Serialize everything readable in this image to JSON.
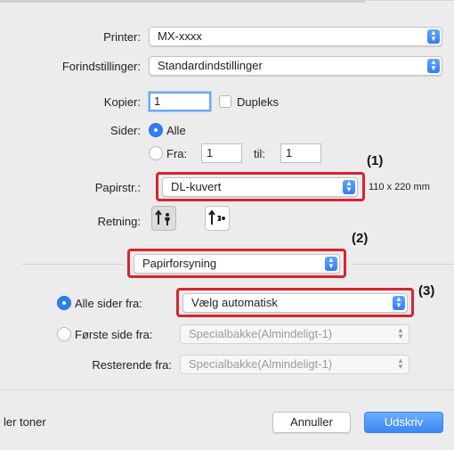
{
  "printer": {
    "label": "Printer:",
    "value": "MX-xxxx"
  },
  "presets": {
    "label": "Forindstillinger:",
    "value": "Standardindstillinger"
  },
  "copies": {
    "label": "Kopier:",
    "value": "1",
    "duplex_label": "Dupleks"
  },
  "pages": {
    "label": "Sider:",
    "all_label": "Alle",
    "from_label": "Fra:",
    "from_value": "1",
    "to_label": "til:",
    "to_value": "1"
  },
  "paper_size": {
    "label": "Papirstr.:",
    "value": "DL-kuvert",
    "dimensions": "110 x 220 mm"
  },
  "orientation": {
    "label": "Retning:"
  },
  "section": {
    "value": "Papirforsyning"
  },
  "all_pages_from": {
    "label": "Alle sider fra:",
    "value": "Vælg automatisk"
  },
  "first_page_from": {
    "label": "Første side fra:",
    "value": "Specialbakke(Almindeligt-1)"
  },
  "remaining_from": {
    "label": "Resterende fra:",
    "value": "Specialbakke(Almindeligt-1)"
  },
  "footer": {
    "left_text": "ler toner",
    "cancel_label": "Annuller",
    "print_label": "Udskriv"
  },
  "callouts": {
    "c1": "(1)",
    "c2": "(2)",
    "c3": "(3)"
  },
  "colors": {
    "accent": "#2f7ef6",
    "highlight": "#d9232f",
    "background": "#ececec"
  },
  "icons": {
    "orientation_portrait": "portrait-person-icon",
    "orientation_landscape": "landscape-person-icon"
  }
}
